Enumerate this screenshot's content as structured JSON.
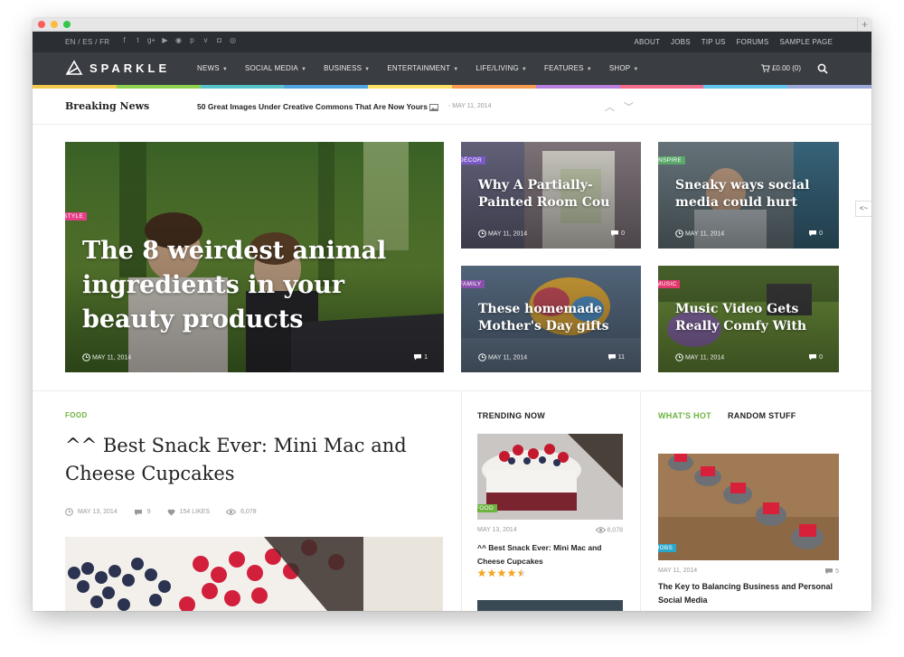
{
  "colors": {
    "accent_green": "#6cb33f",
    "style_tag": "#e53f87",
    "decor_tag": "#7a59c9",
    "inspire_tag": "#5aa86a",
    "family_tag": "#8c4fb0",
    "music_tag": "#e2386e",
    "food_tag": "#6cb33f",
    "jobs_tag": "#2ba6cb",
    "rainbow": [
      "#f2c94c",
      "#8fd14f",
      "#56c2c9",
      "#4fa3e0",
      "#ffe066",
      "#f79c4f",
      "#b87fe0",
      "#f26b8a",
      "#61c7ef",
      "#9aa8d8"
    ]
  },
  "topbar": {
    "languages": "EN / ES / FR",
    "social_icons": [
      "facebook-icon",
      "twitter-icon",
      "google-plus-icon",
      "youtube-icon",
      "rss-icon",
      "pinterest-icon",
      "vimeo-icon",
      "instagram-icon",
      "dribbble-icon"
    ],
    "social_glyphs": [
      "f",
      "t",
      "g+",
      "▶",
      "◉",
      "p",
      "v",
      "◘",
      "◎"
    ],
    "links": [
      "ABOUT",
      "JOBS",
      "TIP US",
      "FORUMS",
      "SAMPLE PAGE"
    ]
  },
  "nav": {
    "logo": "SPARKLE",
    "items": [
      "NEWS",
      "SOCIAL MEDIA",
      "BUSINESS",
      "ENTERTAINMENT",
      "LIFE/LIVING",
      "FEATURES",
      "SHOP"
    ],
    "caret": "▼",
    "cart": "£0.00 (0)"
  },
  "breaking": {
    "label": "Breaking News",
    "title": "50 Great Images Under Creative Commons That Are Now Yours",
    "date": "- MAY 11, 2014",
    "up": "︿",
    "down": "﹀"
  },
  "side_tab": "<~",
  "featured": {
    "main": {
      "category": "STYLE",
      "title": "The 8 weirdest animal ingredients in your beauty products",
      "date": "MAY 11, 2014",
      "comments": "1"
    },
    "cards": [
      {
        "category": "DÉCOR",
        "title": "Why A Partially-Painted Room Cou",
        "date": "MAY 11, 2014",
        "comments": "0"
      },
      {
        "category": "INSPIRE",
        "title": "Sneaky ways social media could hurt",
        "date": "MAY 11, 2014",
        "comments": "0"
      },
      {
        "category": "FAMILY",
        "title": "These homemade Mother's Day gifts",
        "date": "MAY 11, 2014",
        "comments": "11"
      },
      {
        "category": "MUSIC",
        "title": "Music Video Gets Really Comfy With",
        "date": "MAY 11, 2014",
        "comments": "0"
      }
    ]
  },
  "food_post": {
    "category": "FOOD",
    "title": "^^ Best Snack Ever: Mini Mac and Cheese Cupcakes",
    "date": "MAY 13, 2014",
    "comments": "9",
    "likes": "154 LIKES",
    "views": "6,078"
  },
  "trending": {
    "heading": "TRENDING NOW",
    "category": "FOOD",
    "date": "MAY 13, 2014",
    "views": "6,078",
    "title": "^^ Best Snack Ever: Mini Mac and Cheese Cupcakes",
    "rating": 4.5
  },
  "hot": {
    "tab_active": "WHAT'S HOT",
    "tab_other": "RANDOM STUFF",
    "category": "JOBS",
    "date": "MAY 11, 2014",
    "comments": "5",
    "title": "The Key to Balancing Business and Personal Social Media"
  }
}
